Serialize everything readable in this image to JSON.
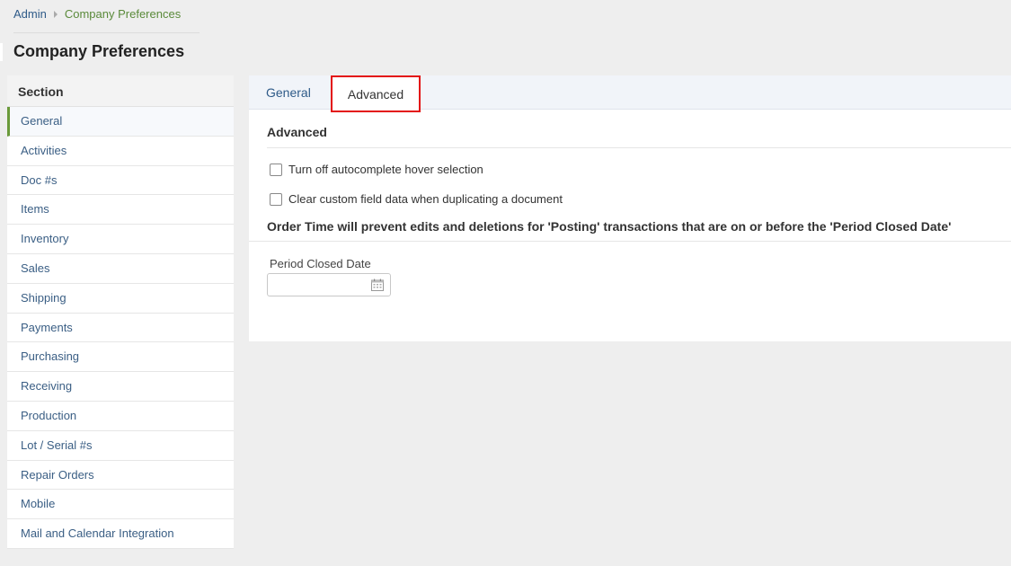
{
  "breadcrumb": {
    "root": "Admin",
    "current": "Company Preferences"
  },
  "page": {
    "title": "Company Preferences"
  },
  "sidebar": {
    "header": "Section",
    "items": [
      {
        "label": "General",
        "active": true
      },
      {
        "label": "Activities"
      },
      {
        "label": "Doc #s"
      },
      {
        "label": "Items"
      },
      {
        "label": "Inventory"
      },
      {
        "label": "Sales"
      },
      {
        "label": "Shipping"
      },
      {
        "label": "Payments"
      },
      {
        "label": "Purchasing"
      },
      {
        "label": "Receiving"
      },
      {
        "label": "Production"
      },
      {
        "label": "Lot / Serial #s"
      },
      {
        "label": "Repair Orders"
      },
      {
        "label": "Mobile"
      },
      {
        "label": "Mail and Calendar Integration"
      }
    ]
  },
  "tabs": {
    "general": "General",
    "advanced": "Advanced",
    "active": "Advanced"
  },
  "advanced": {
    "section_title": "Advanced",
    "options": [
      {
        "label": "Turn off autocomplete hover selection",
        "checked": false
      },
      {
        "label": "Clear custom field data when duplicating a document",
        "checked": false
      }
    ],
    "notice": "Order Time will prevent edits and deletions for 'Posting' transactions that are on or before the 'Period Closed Date'",
    "period_closed_date": {
      "label": "Period Closed Date",
      "value": ""
    }
  },
  "colors": {
    "link_blue": "#2e5a88",
    "breadcrumb_green": "#5a8a3a",
    "active_marker": "#6a9a3a",
    "highlight_red": "#e31212"
  },
  "icons": {
    "breadcrumb_separator": "chevron-right-icon",
    "date_picker": "calendar-icon"
  }
}
